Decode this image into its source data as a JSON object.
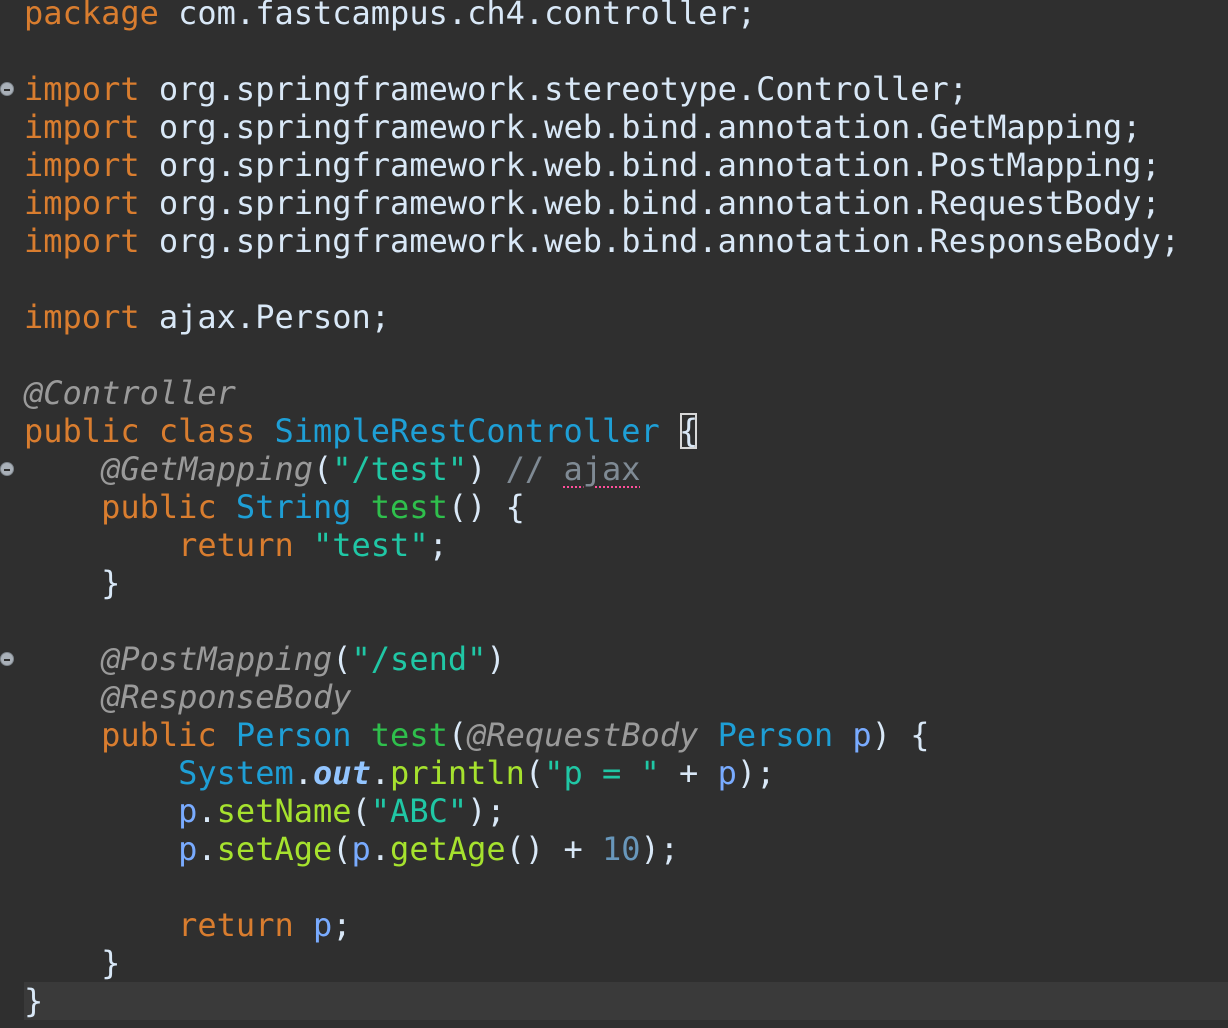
{
  "editor": {
    "code": {
      "package": {
        "kw": "package",
        "name": " com.fastcampus.ch4.controller;"
      },
      "imports": [
        {
          "kw": "import",
          "path": " org.springframework.stereotype.Controller;"
        },
        {
          "kw": "import",
          "path": " org.springframework.web.bind.annotation.GetMapping;"
        },
        {
          "kw": "import",
          "path": " org.springframework.web.bind.annotation.PostMapping;"
        },
        {
          "kw": "import",
          "path": " org.springframework.web.bind.annotation.RequestBody;"
        },
        {
          "kw": "import",
          "path": " org.springframework.web.bind.annotation.ResponseBody;"
        }
      ],
      "import_person": {
        "kw": "import",
        "path": " ajax.Person;"
      },
      "class_annotation": "@Controller",
      "class_decl": {
        "public": "public",
        "class": "class",
        "name": "SimpleRestController",
        "open_brace": "{"
      },
      "get_mapping": {
        "annotation": "@GetMapping",
        "open": "(",
        "arg": "\"/test\"",
        "close": ")",
        "comment_prefix": "// ",
        "comment_word": "ajax"
      },
      "method1": {
        "public": "public",
        "return_type": "String",
        "name": "test",
        "signature_end": "() {",
        "return_kw": "return",
        "return_value": "\"test\"",
        "semicolon": ";",
        "close": "}"
      },
      "post_mapping": {
        "annotation": "@PostMapping",
        "open": "(",
        "arg": "\"/send\"",
        "close": ")"
      },
      "response_body": "@ResponseBody",
      "method2": {
        "public": "public",
        "return_type": "Person",
        "name": "test",
        "paren_open": "(",
        "param_annotation": "@RequestBody",
        "param_type": "Person",
        "param_name": "p",
        "signature_end": ") {",
        "line1": {
          "system": "System",
          "dot1": ".",
          "out": "out",
          "dot2": ".",
          "println": "println",
          "open": "(",
          "str": "\"p = \"",
          "plus": " + ",
          "p": "p",
          "end": ");"
        },
        "line2": {
          "p": "p",
          "dot": ".",
          "method": "setName",
          "open": "(",
          "str": "\"ABC\"",
          "end": ");"
        },
        "line3": {
          "p": "p",
          "dot": ".",
          "method": "setAge",
          "open": "(",
          "p2": "p",
          "dot2": ".",
          "getter": "getAge",
          "mid": "() + ",
          "num": "10",
          "end": ");"
        },
        "return_kw": "return",
        "return_value": "p",
        "semicolon": ";",
        "close": "}"
      },
      "class_close": "}"
    }
  }
}
